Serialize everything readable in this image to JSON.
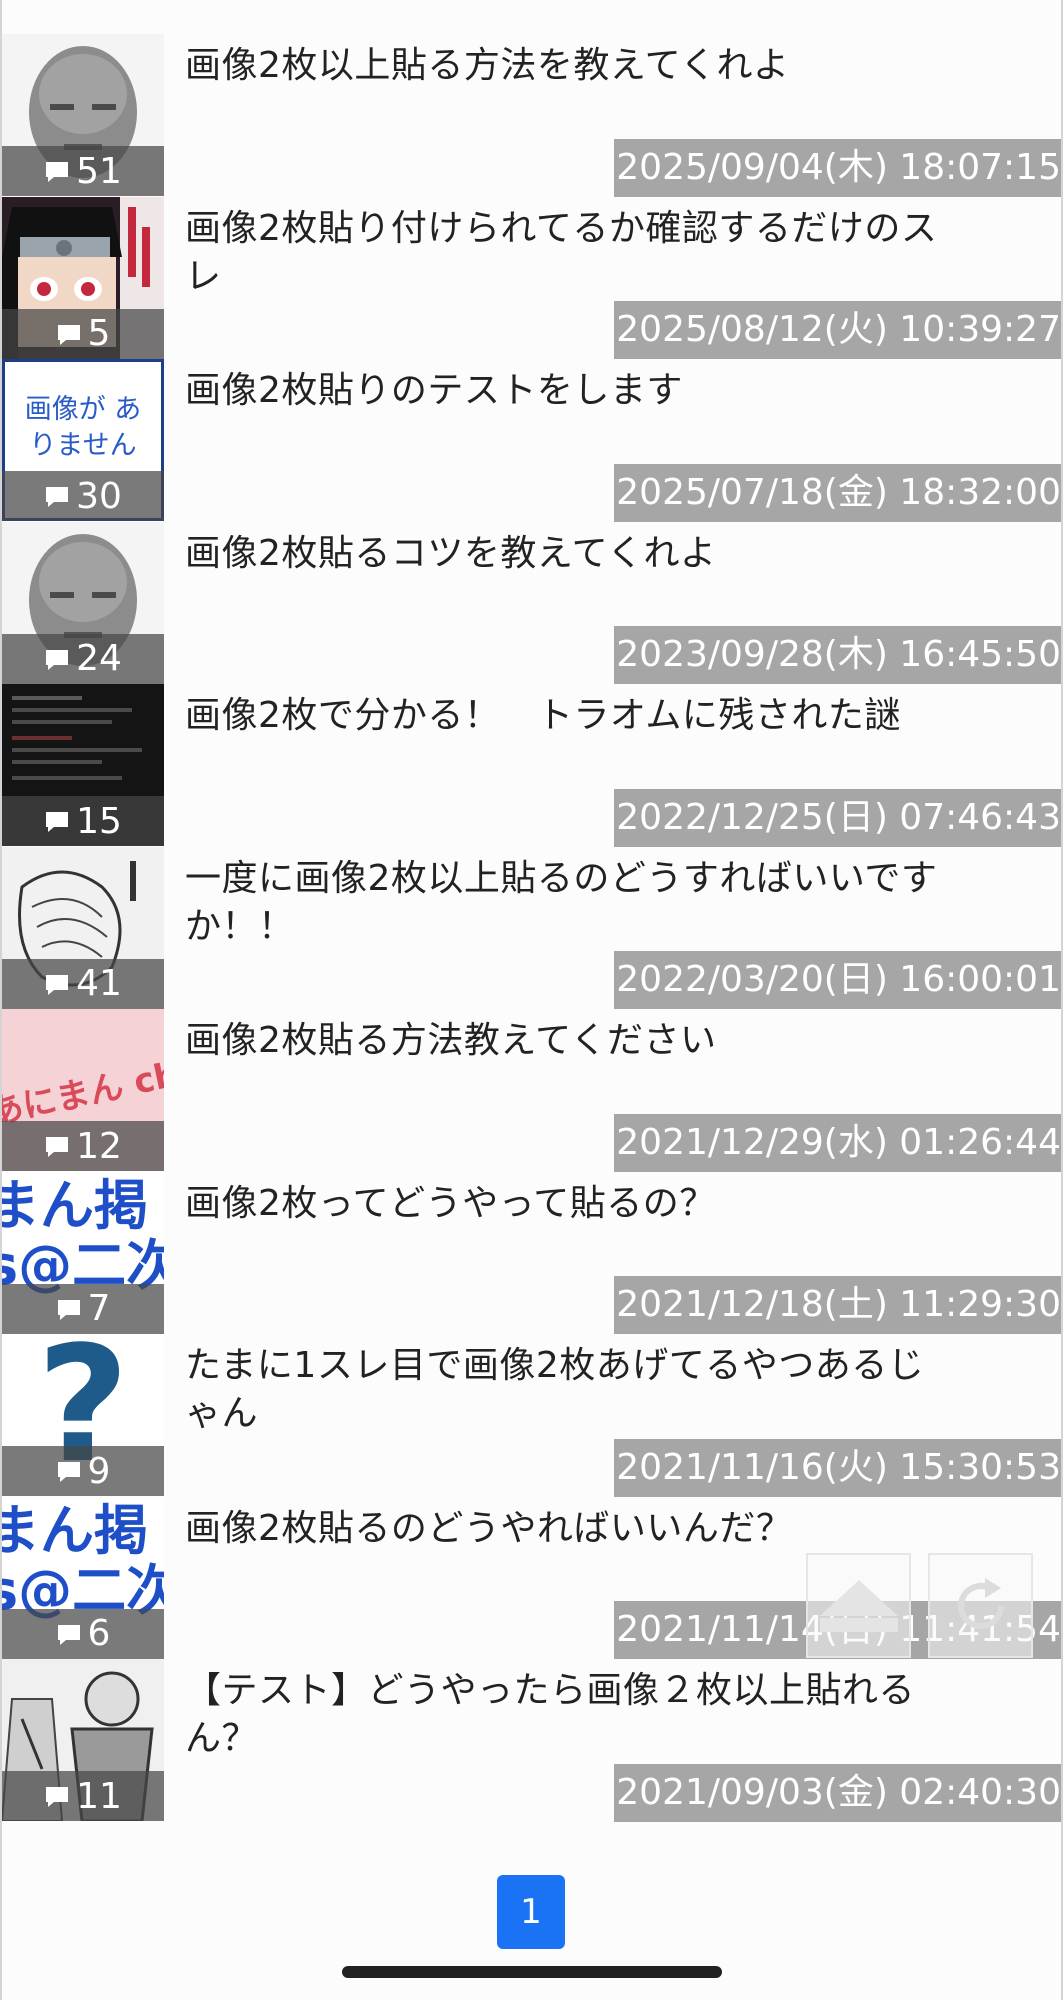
{
  "threads": [
    {
      "title": "画像2枚以上貼る方法を教えてくれよ",
      "count": "51",
      "date": "2025/09/04(木) 18:07:15",
      "thumb": "face-bald-man"
    },
    {
      "title": "画像2枚貼り付けられてるか確認するだけのスレ",
      "count": "5",
      "date": "2025/08/12(火) 10:39:27",
      "thumb": "anime-ninja"
    },
    {
      "title": "画像2枚貼りのテストをします",
      "count": "30",
      "date": "2025/07/18(金) 18:32:00",
      "thumb": "no-image",
      "thumb_text": "画像が ありません"
    },
    {
      "title": "画像2枚貼るコツを教えてくれよ",
      "count": "24",
      "date": "2023/09/28(木) 16:45:50",
      "thumb": "face-bald-man"
    },
    {
      "title": "画像2枚で分かる！　トラオムに残された謎",
      "count": "15",
      "date": "2022/12/25(日) 07:46:43",
      "thumb": "dark-text"
    },
    {
      "title": "一度に画像2枚以上貼るのどうすればいいですか！！",
      "count": "41",
      "date": "2022/03/20(日) 16:00:01",
      "thumb": "manga-sketch"
    },
    {
      "title": "画像2枚貼る方法教えてください",
      "count": "12",
      "date": "2021/12/29(水) 01:26:44",
      "thumb": "pink-logo",
      "thumb_text": "あにまん ch"
    },
    {
      "title": "画像2枚ってどうやって貼るの？",
      "count": "7",
      "date": "2021/12/18(土) 11:29:30",
      "thumb": "blue-text",
      "thumb_text": "まん掲 s@二次"
    },
    {
      "title": "たまに1スレ目で画像2枚あげてるやつあるじゃん",
      "count": "9",
      "date": "2021/11/16(火) 15:30:53",
      "thumb": "question-mark",
      "thumb_text": "?"
    },
    {
      "title": "画像2枚貼るのどうやればいいんだ？",
      "count": "6",
      "date": "2021/11/14(日) 11:41:54",
      "thumb": "blue-text",
      "thumb_text": "まん掲 s@二次"
    },
    {
      "title": "【テスト】どうやったら画像２枚以上貼れるん？",
      "count": "11",
      "date": "2021/09/03(金) 02:40:30",
      "thumb": "manga-samurai"
    }
  ],
  "pagination": {
    "current": "1"
  },
  "icons": {
    "comment": "comment-bubble-icon",
    "scroll_top": "home-up-icon",
    "reload": "reload-icon"
  },
  "colors": {
    "accent": "#1a73f5",
    "date_bg": "#a6a6a6",
    "count_bg": "#464646"
  }
}
